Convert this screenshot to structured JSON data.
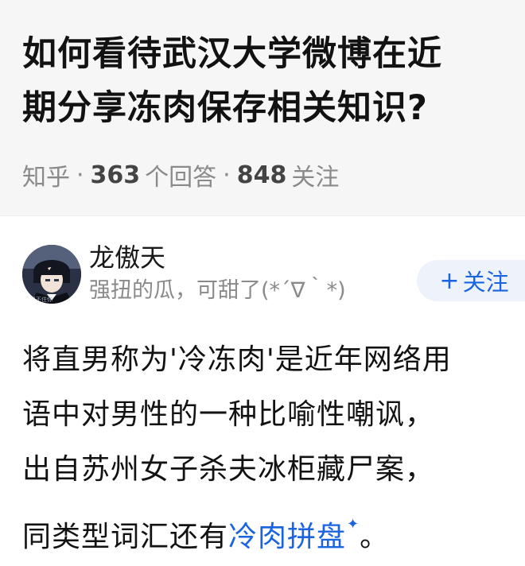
{
  "question": {
    "title_line1": "如何看待武汉大学微博在近",
    "title_line2": "期分享冻肉保存相关知识?",
    "source": "知乎",
    "answers_count": "363",
    "answers_label": "个回答",
    "followers_count": "848",
    "followers_label": "关注"
  },
  "author": {
    "name": "龙傲天",
    "bio": "强扭的瓜，可甜了(*´∇｀*)",
    "follow_plus": "+",
    "follow_label": "关注"
  },
  "answer": {
    "line1": "将直男称为'冷冻肉'是近年网络用",
    "line2": "语中对男性的一种比喻性嘲讽，",
    "line3": "出自苏州女子杀夫冰柜藏尸案，",
    "line4_prefix": "同类型词汇还有",
    "line4_link": "冷肉拼盘",
    "line4_suffix": "。"
  },
  "colors": {
    "link": "#1b64e0",
    "muted": "#8a8a8a",
    "header_bg": "#f6f6f6",
    "follow_bg": "#eef3fb"
  },
  "icons": {
    "avatar": "anime-avatar",
    "link_marker": "sparkle-icon"
  }
}
